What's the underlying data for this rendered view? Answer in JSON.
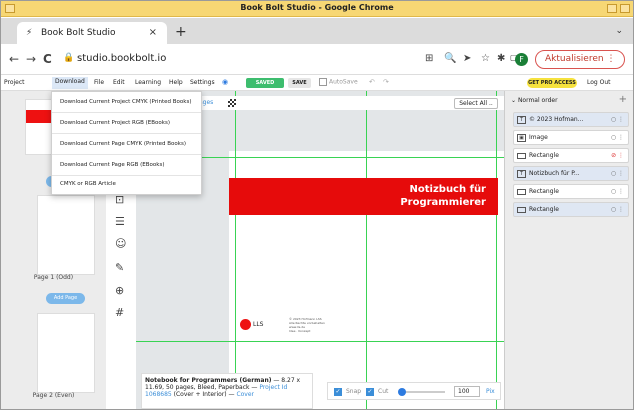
{
  "window": {
    "title": "Book Bolt Studio - Google Chrome"
  },
  "tab": {
    "title": "Book Bolt Studio",
    "close": "×",
    "new": "+",
    "menu": "⌄"
  },
  "omnibox": {
    "back": "←",
    "forward": "→",
    "reload": "C",
    "url": "studio.bookbolt.io",
    "update_label": "Aktualisieren",
    "profile_letter": "F"
  },
  "menubar": {
    "items": [
      "Project",
      "Download",
      "File",
      "Edit",
      "Learning",
      "Help",
      "Settings"
    ],
    "saved": "SAVED",
    "save": "SAVE",
    "autosave": "AutoSave",
    "pro": "GET PRO ACCESS",
    "logout": "Log Out"
  },
  "download_menu": [
    "Download Current Project CMYK (Printed Books)",
    "Download Current Project RGB (EBooks)",
    "Download Current Page CMYK (Printed Books)",
    "Download Current Page RGB (EBooks)",
    "CMYK or RGB Article"
  ],
  "pages": [
    {
      "label": "Page 1 (Odd)"
    },
    {
      "label": "Page 2 (Even)"
    }
  ],
  "add_page": "Add Page",
  "canvas": {
    "pages_link": "ages",
    "select_all": "Select All ..",
    "banner_line1": "Notizbuch für",
    "banner_line2": "Programmierer",
    "logo_text": "LLS",
    "imprint": "© 2023 Hofmann LSS\nAlle Rechte vorbehalten\nwww.lls.de\nIdee · Konzept"
  },
  "info": {
    "title": "Notebook for Programmers (German)",
    "details": " — 8.27 x 11.69, 50 pages, Bleed, Paperback — ",
    "project_id": "Project Id 1068685",
    "suffix": " (Cover + Interior) — ",
    "cover": "Cover"
  },
  "bottom": {
    "snap": "Snap",
    "cut": "Cut",
    "zoom": "100",
    "unit": "Pix"
  },
  "layers": {
    "header": "Normal order",
    "items": [
      {
        "label": "© 2023 Hofman...",
        "icon": "T",
        "selected": true,
        "action": "○ ⋮"
      },
      {
        "label": "Image",
        "icon": "▣",
        "selected": false,
        "action": "○ ⋮"
      },
      {
        "label": "Rectangle",
        "icon": "",
        "selected": false,
        "action": "⊘ ⋮"
      },
      {
        "label": "Notizbuch für P...",
        "icon": "T",
        "selected": true,
        "action": "○ ⋮"
      },
      {
        "label": "Rectangle",
        "icon": "",
        "selected": false,
        "action": "○ ⋮"
      },
      {
        "label": "Rectangle",
        "icon": "",
        "selected": true,
        "action": "○ ⋮"
      }
    ]
  }
}
